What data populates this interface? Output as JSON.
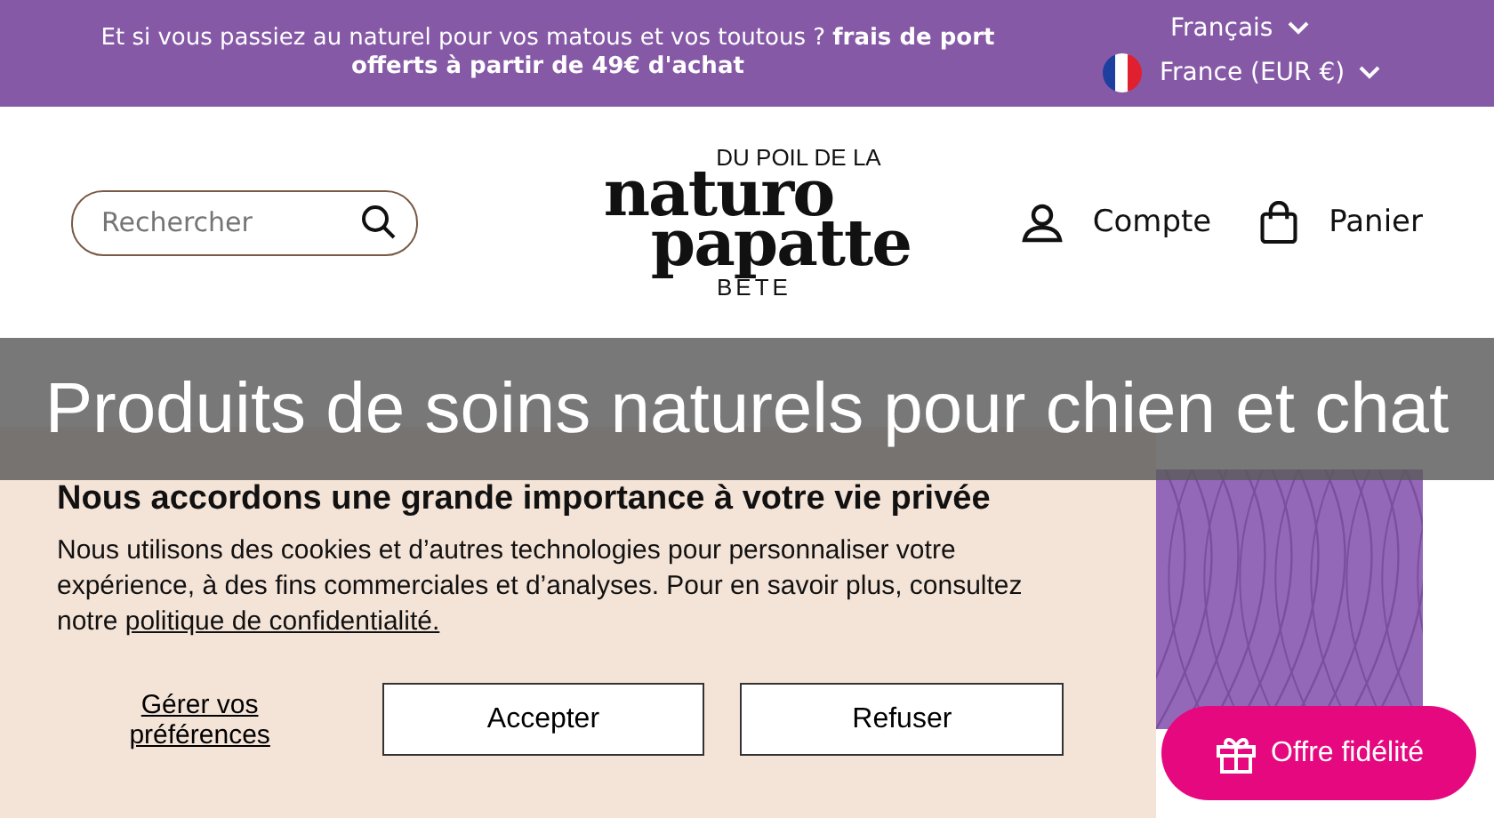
{
  "announcement": {
    "text": "Et si vous passiez au naturel pour vos matous et vos toutous ? **frais de port offerts à partir de 49€ d'achat**",
    "language": "Français",
    "country": "France (EUR €)"
  },
  "header": {
    "search": {
      "placeholder": "Rechercher"
    },
    "logo": {
      "top": "DU POIL DE LA",
      "line1": "naturo",
      "line2": "papatte",
      "bottom": "BÊTE"
    },
    "account": "Compte",
    "cart": "Panier"
  },
  "overlay": {
    "title": "Produits de soins naturels pour chien et chat"
  },
  "cookie_banner": {
    "title": "Nous accordons une grande importance à votre vie privée",
    "text": "Nous utilisons des cookies et d’autres technologies pour personnaliser votre expérience, à des fins commerciales et d’analyses. Pour en savoir plus, consultez notre",
    "link": "politique de confidentialité.",
    "manage": "Gérer vos préférences",
    "accept": "Accepter",
    "refuse": "Refuser"
  },
  "loyalty_button": {
    "label": "Offre fidélité"
  }
}
